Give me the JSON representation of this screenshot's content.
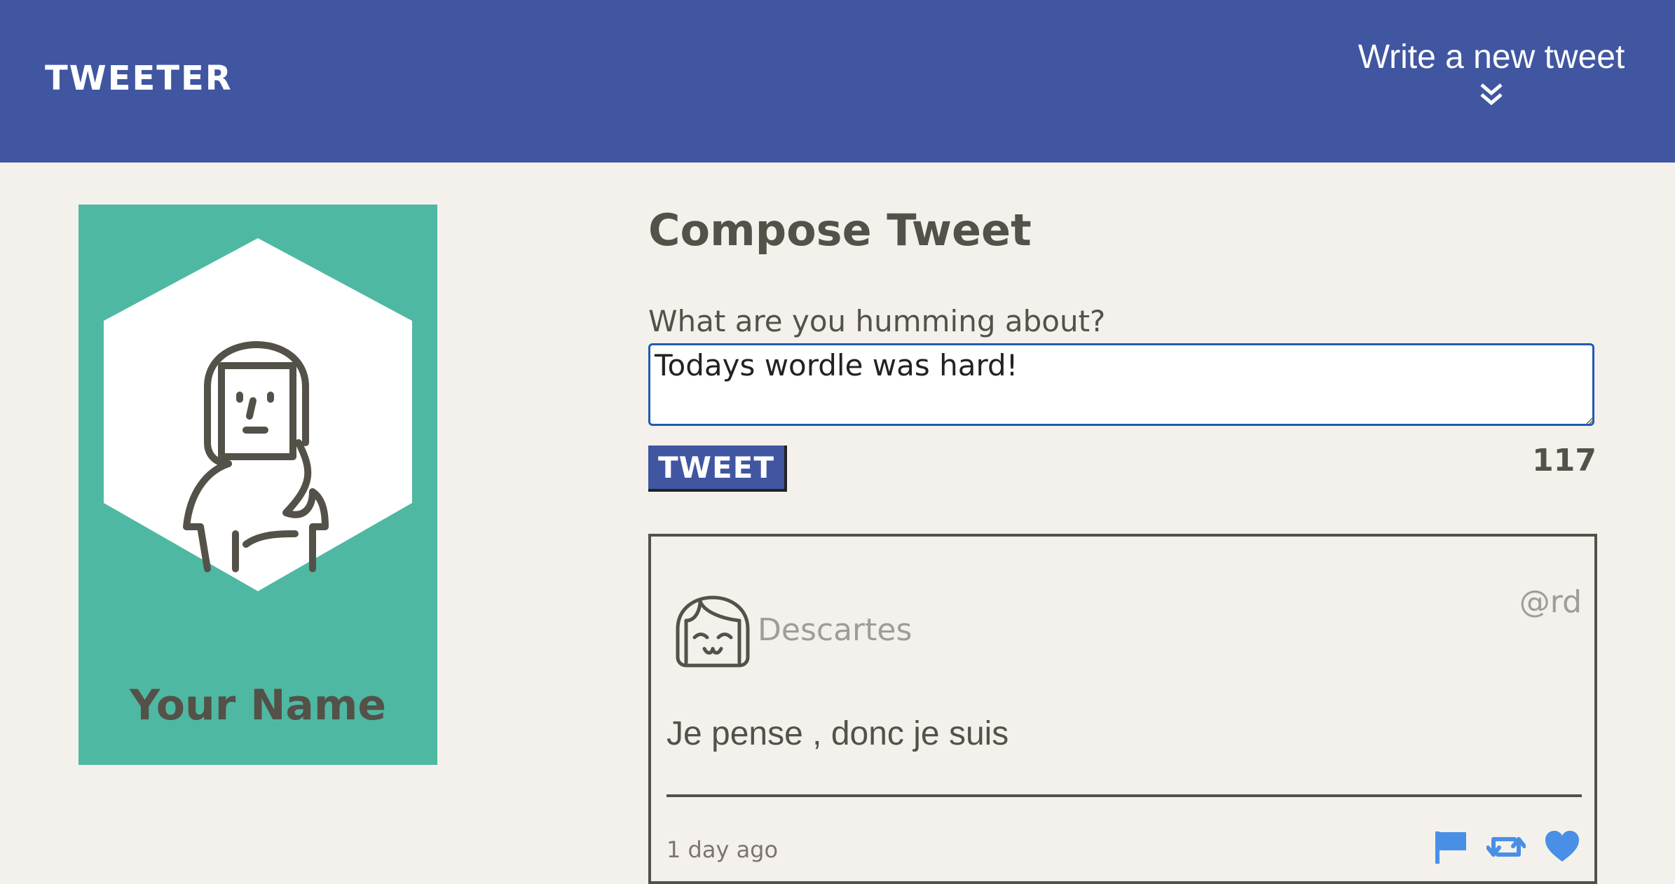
{
  "nav": {
    "brand": "TWEETER",
    "new_tweet_label": "Write a new tweet",
    "new_tweet_icon": "double-chevron-down-icon"
  },
  "profile": {
    "name": "Your Name",
    "avatar_icon": "user-avatar-icon",
    "card_color": "#4fb8a3"
  },
  "compose": {
    "title": "Compose Tweet",
    "label": "What are you humming about?",
    "value": "Todays wordle was hard!",
    "submit_label": "TWEET",
    "counter": "117"
  },
  "tweets": [
    {
      "name": "Descartes",
      "handle": "@rd",
      "content": "Je pense , donc je suis",
      "time": "1 day ago",
      "actions": [
        "flag-icon",
        "retweet-icon",
        "heart-icon"
      ]
    }
  ],
  "colors": {
    "nav": "#4056a1",
    "background": "#f4f1ec",
    "text": "#545149",
    "action_icons": "#4a8fe6"
  }
}
